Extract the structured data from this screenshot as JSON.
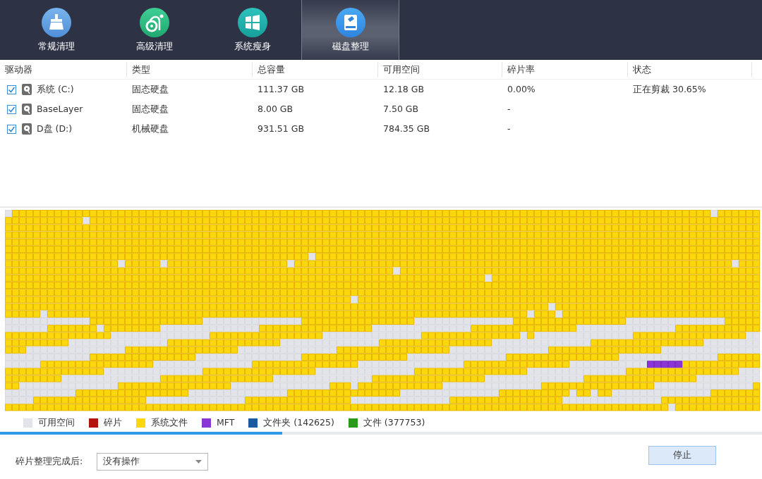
{
  "tabs": [
    {
      "label": "常规清理",
      "kind": "broom",
      "selected": false
    },
    {
      "label": "高级清理",
      "kind": "vacuum",
      "selected": false
    },
    {
      "label": "系统瘦身",
      "kind": "windows",
      "selected": false
    },
    {
      "label": "磁盘整理",
      "kind": "disk",
      "selected": true
    }
  ],
  "table": {
    "columns": [
      "驱动器",
      "类型",
      "总容量",
      "可用空间",
      "碎片率",
      "状态"
    ],
    "rows": [
      {
        "checked": true,
        "drive": "系统 (C:)",
        "type": "固态硬盘",
        "total": "111.37 GB",
        "free": "12.18 GB",
        "fragmentation": "0.00%",
        "status": "正在剪裁 30.65%"
      },
      {
        "checked": true,
        "drive": "BaseLayer",
        "type": "固态硬盘",
        "total": "8.00 GB",
        "free": "7.50 GB",
        "fragmentation": "-"
      },
      {
        "checked": true,
        "drive": "D盘 (D:)",
        "type": "机械硬盘",
        "total": "931.51 GB",
        "free": "784.35 GB",
        "fragmentation": "-"
      }
    ]
  },
  "legend": [
    {
      "label": "可用空间",
      "color": "#e2e4ea"
    },
    {
      "label": "碎片",
      "color": "#b5140e"
    },
    {
      "label": "系统文件",
      "color": "#fbd80c"
    },
    {
      "label": "MFT",
      "color": "#8a35d6"
    },
    {
      "label": "文件夹 (142625)",
      "color": "#1b5aa0"
    },
    {
      "label": "文件 (377753)",
      "color": "#2b9a1c"
    }
  ],
  "progress": {
    "level": 0.37
  },
  "after_done": {
    "label": "碎片整理完成后:",
    "value": "没有操作"
  },
  "stop_button": "停止"
}
